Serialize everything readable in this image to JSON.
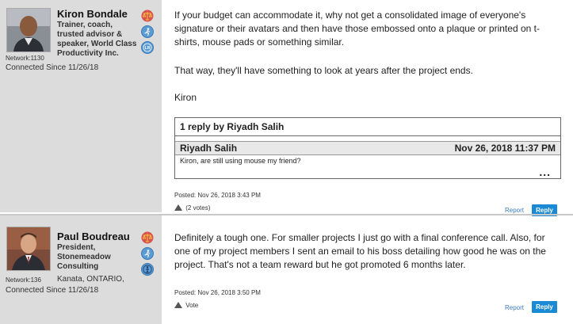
{
  "posts": [
    {
      "author": {
        "name": "Kiron Bondale",
        "title": "Trainer, coach, trusted advisor & speaker, World Class Productivity Inc.",
        "location": "",
        "network": "Network:1130",
        "connected": "Connected Since 11/26/18",
        "badges": [
          "scales-badge-icon",
          "runner-badge-icon",
          "certification-badge-icon"
        ]
      },
      "paragraphs": [
        "If your budget can accommodate it, why not get a consolidated image of everyone's signature or their avatars and then have those embossed onto a plaque or printed on t-shirts, mouse pads or something similar.",
        "That way, they'll have something to look at years after the project ends.",
        "Kiron"
      ],
      "reply_thread": {
        "header": "1 reply by Riyadh Salih",
        "author": "Riyadh Salih",
        "date": "Nov 26, 2018 11:37 PM",
        "text": "Kiron, are still using mouse my friend?",
        "more": "..."
      },
      "posted": "Posted: Nov 26, 2018 3:43 PM",
      "votes": "(2 votes)",
      "report_label": "Report",
      "reply_label": "Reply"
    },
    {
      "author": {
        "name": "Paul Boudreau",
        "title": "President, Stonemeadow Consulting",
        "location": "Kanata, ONTARIO,",
        "network": "Network:136",
        "connected": "Connected Since 11/26/18",
        "badges": [
          "scales-badge-icon",
          "runner-badge-icon",
          "person-badge-icon"
        ]
      },
      "paragraphs": [
        "Definitely a tough one. For smaller projects I just go with a final conference call. Also, for one of my project members I sent an email to his boss detailing how good he was on the project. That's not a team reward but he got promoted 6 months later."
      ],
      "posted": "Posted: Nov 26, 2018 3:50 PM",
      "votes": "Vote",
      "report_label": "Report",
      "reply_label": "Reply"
    }
  ],
  "colors": {
    "sidebar_bg": "#dcdcdc",
    "badge_red": "#d9534f",
    "badge_blue": "#5b9bd5",
    "reply_button": "#1a8ad4",
    "link": "#3a7cc0"
  }
}
